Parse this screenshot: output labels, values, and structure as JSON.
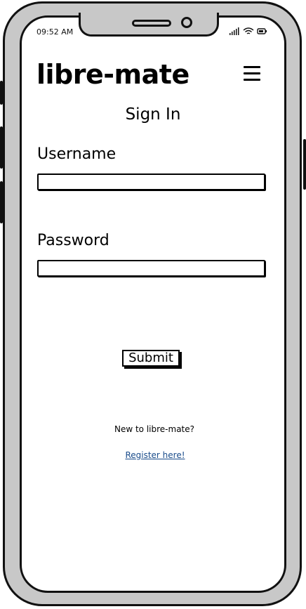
{
  "status_bar": {
    "time": "09:52 AM",
    "icons": [
      "signal-icon",
      "wifi-icon",
      "battery-icon"
    ]
  },
  "header": {
    "app_title": "libre-mate",
    "menu_icon": "hamburger-menu-icon"
  },
  "main": {
    "page_title": "Sign In",
    "username": {
      "label": "Username",
      "value": "",
      "placeholder": ""
    },
    "password": {
      "label": "Password",
      "value": "",
      "placeholder": ""
    },
    "submit_label": "Submit",
    "new_user_text": "New to libre-mate?",
    "register_link": "Register here!"
  },
  "colors": {
    "frame": "#c8c8c8",
    "outline": "#111111",
    "link": "#1a4c8b"
  }
}
